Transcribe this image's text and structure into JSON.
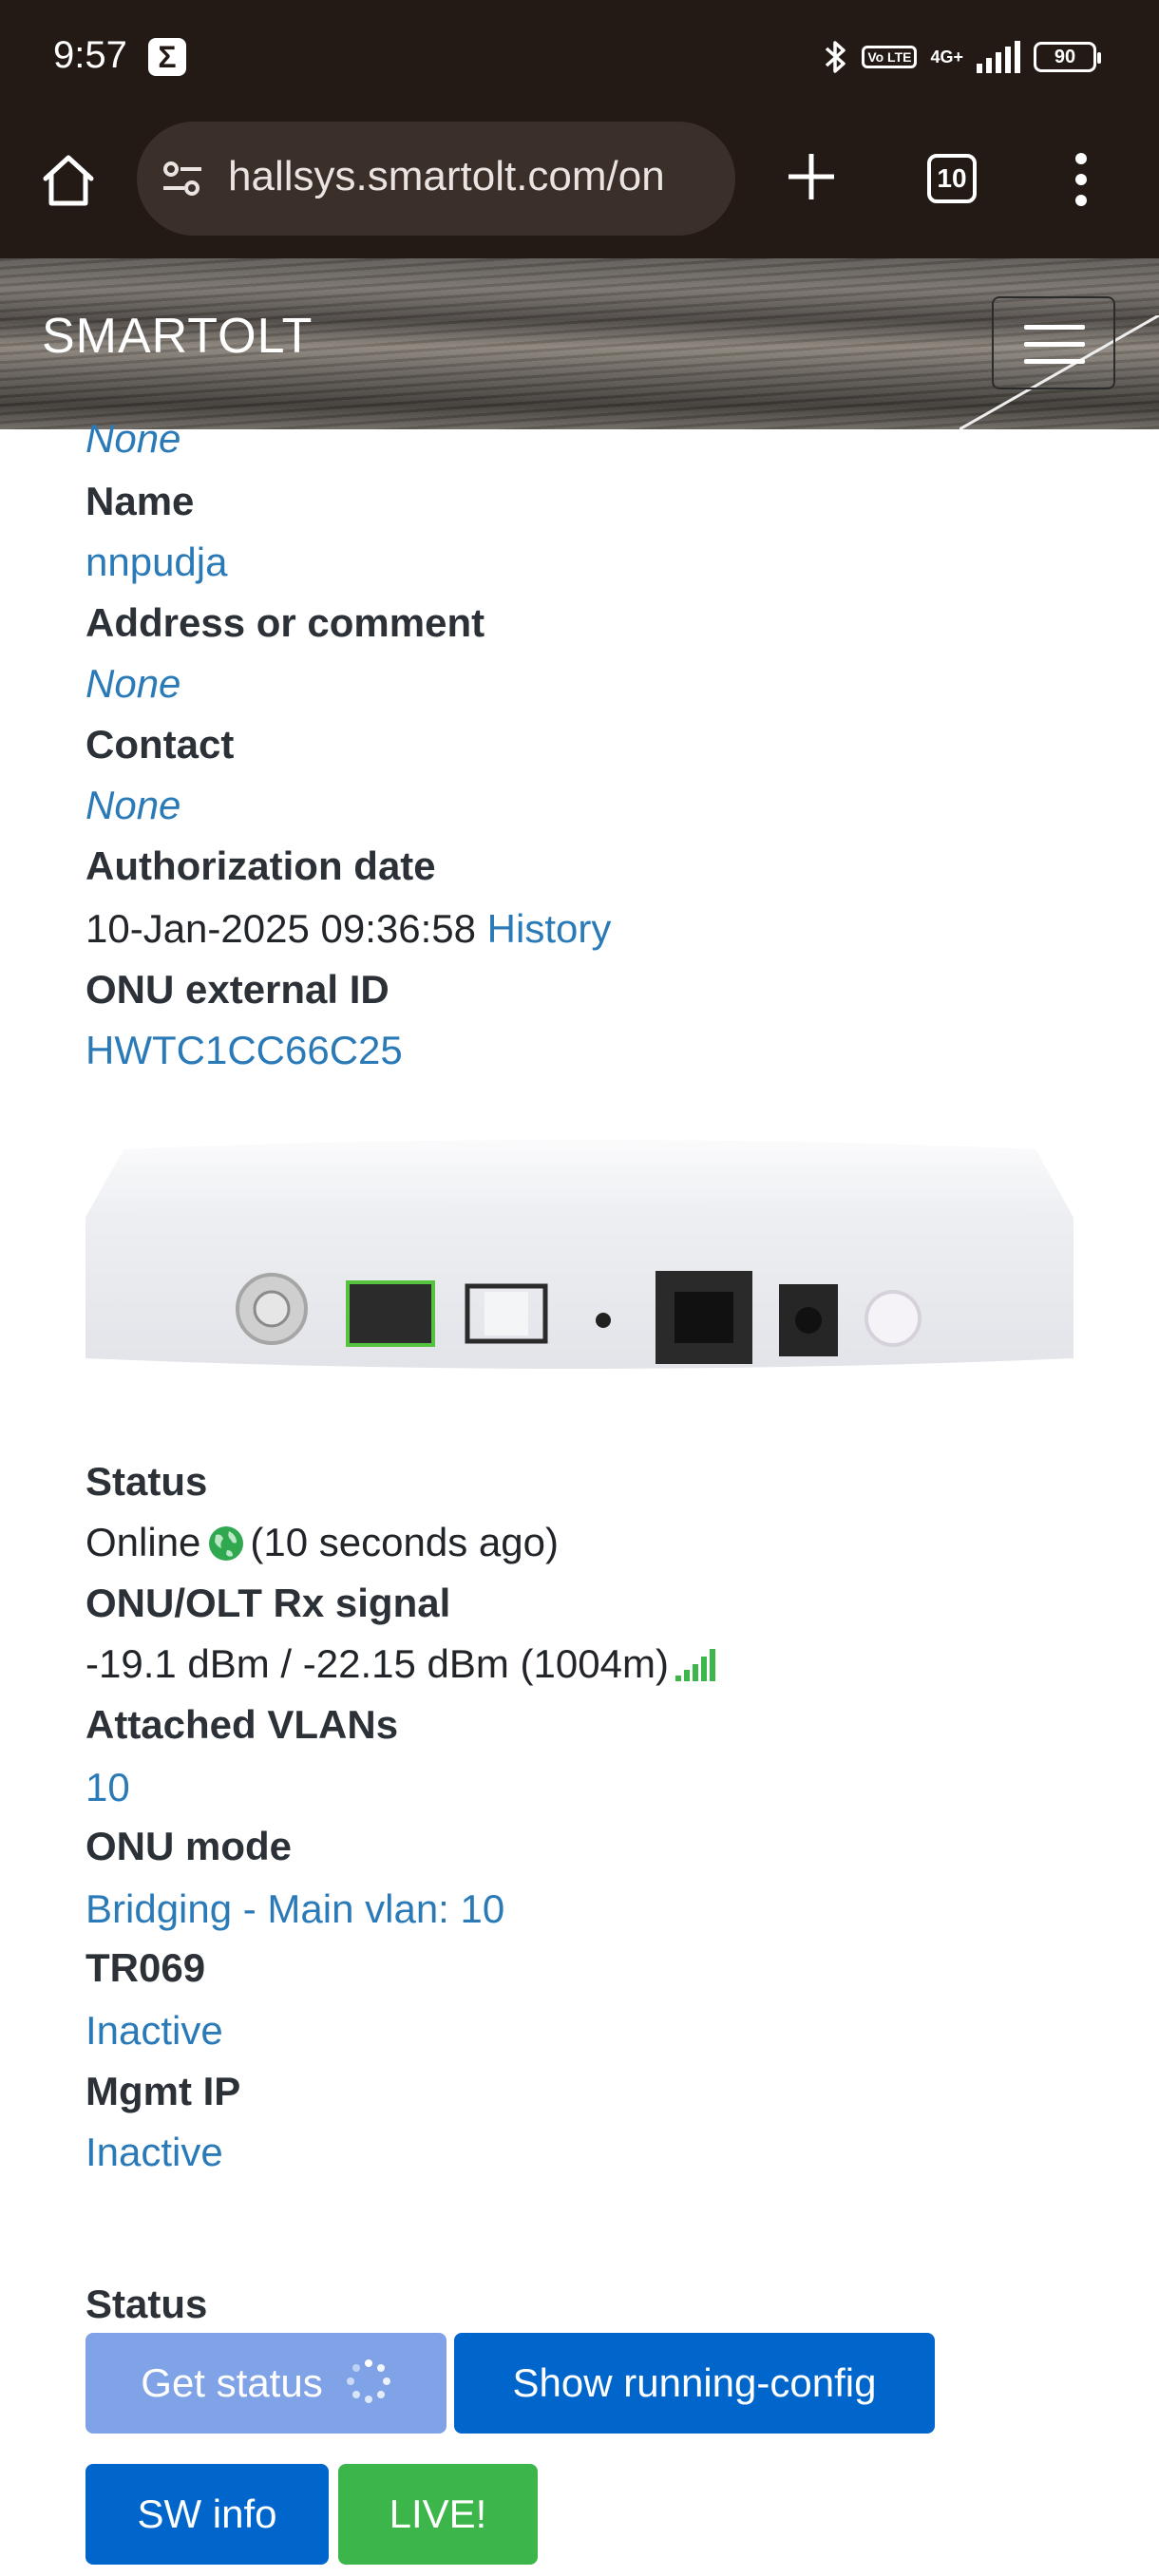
{
  "status_bar": {
    "time": "9:57",
    "sigma_icon": "Σ",
    "bluetooth_icon": "bluetooth-icon",
    "volte": "Vo LTE",
    "network": "4G+",
    "battery": "90"
  },
  "browser": {
    "url": "hallsys.smartolt.com/on",
    "tab_count": "10"
  },
  "header": {
    "brand": "SMARTOLT"
  },
  "details": {
    "top_value": "None",
    "name_label": "Name",
    "name_value": "nnpudja",
    "address_label": "Address or comment",
    "address_value": "None",
    "contact_label": "Contact",
    "contact_value": "None",
    "auth_label": "Authorization date",
    "auth_value": "10-Jan-2025 09:36:58",
    "auth_history_link": "History",
    "external_id_label": "ONU external ID",
    "external_id_value": "HWTC1CC66C25"
  },
  "status_block": {
    "status_label": "Status",
    "status_value": "Online",
    "status_ago": "(10 seconds ago)",
    "rx_label": "ONU/OLT Rx signal",
    "rx_value": "-19.1 dBm / -22.15 dBm (1004m)",
    "vlans_label": "Attached VLANs",
    "vlans_value": "10",
    "mode_label": "ONU mode",
    "mode_value": "Bridging - Main vlan: 10",
    "tr069_label": "TR069",
    "tr069_value": "Inactive",
    "mgmt_label": "Mgmt IP",
    "mgmt_value": "Inactive"
  },
  "actions": {
    "section_label": "Status",
    "get_status": "Get status",
    "show_running_config": "Show running-config",
    "sw_info": "SW info",
    "live": "LIVE!"
  },
  "colors": {
    "link": "#2b7ab8",
    "primary": "#0066cc",
    "disabled": "#7fa3e6",
    "success": "#3cb54a",
    "chrome": "#241a15"
  }
}
